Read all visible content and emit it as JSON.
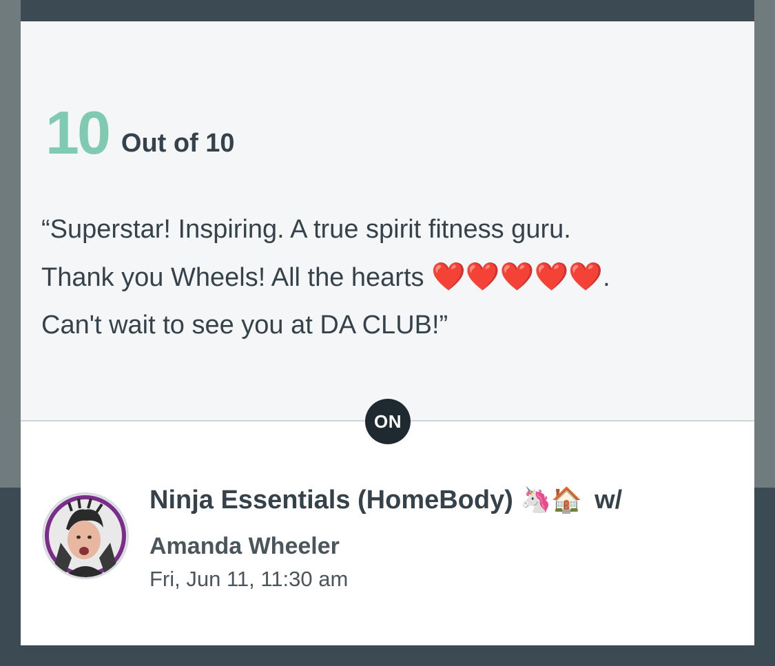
{
  "review": {
    "score": "10",
    "out_of": "Out of 10",
    "quote_line1": "“Superstar! Inspiring. A true spirit fitness guru.",
    "quote_line2_pre": "Thank you Wheels! All the hearts ",
    "hearts": [
      "❤️",
      "❤️",
      "❤️",
      "❤️",
      "❤️"
    ],
    "quote_line2_post": ".",
    "quote_line3": "Can't wait to see you at DA CLUB!”"
  },
  "divider": {
    "badge": "ON"
  },
  "session": {
    "class_name": "Ninja Essentials (HomeBody)",
    "emojis": [
      "🦄",
      "🏠"
    ],
    "with": "w/",
    "instructor": "Amanda Wheeler",
    "datetime": "Fri, Jun 11, 11:30 am"
  },
  "colors": {
    "score": "#7fcab0",
    "text": "#36424a",
    "badge": "#1f2a30",
    "avatar_ring": "#7a2d8a"
  }
}
